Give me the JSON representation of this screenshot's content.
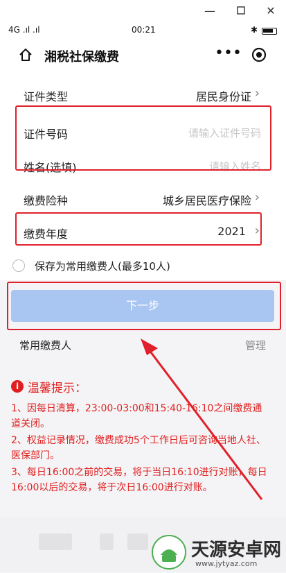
{
  "status_bar": {
    "left": "4G .ıl .ıl",
    "time": "00:21",
    "right": "✱"
  },
  "app": {
    "title": "湘税社保缴费"
  },
  "form": {
    "id_type_label": "证件类型",
    "id_type_value": "居民身份证",
    "id_number_label": "证件号码",
    "id_number_placeholder": "请输入证件号码",
    "name_label": "姓名(选填)",
    "name_placeholder": "请输入姓名",
    "insurance_label": "缴费险种",
    "insurance_value": "城乡居民医疗保险",
    "year_label": "缴费年度",
    "year_value": "2021"
  },
  "save_checkbox_label": "保存为常用缴费人(最多10人)",
  "next_button": "下一步",
  "frequent": {
    "label": "常用缴费人",
    "manage": "管理"
  },
  "tips": {
    "title": "温馨提示：",
    "items": [
      "1、因每日清算，23:00-03:00和15:40-16:10之间缴费通道关闭。",
      "2、权益记录情况，缴费成功5个工作日后可咨询当地人社、医保部门。",
      "3、每日16:00之前的交易，将于当日16:10进行对账，每日16:00以后的交易，将于次日16:00进行对账。"
    ]
  },
  "watermark": {
    "title": "天源安卓网",
    "url": "www.jytyaz.com"
  },
  "colors": {
    "accent_red": "#e0202a",
    "button_disabled": "#a9c6f2",
    "tip_red": "#e02020"
  }
}
